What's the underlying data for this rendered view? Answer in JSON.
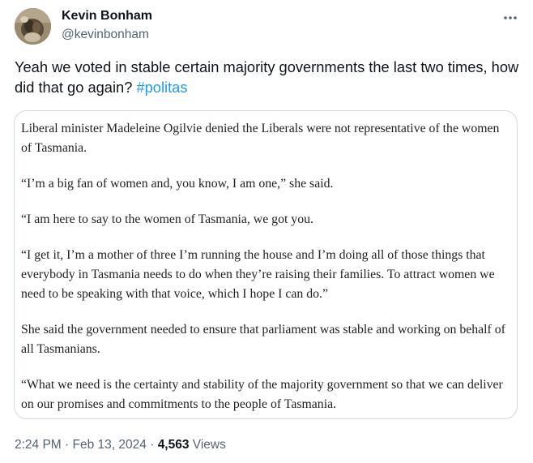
{
  "author": {
    "display_name": "Kevin Bonham",
    "handle": "@kevinbonham"
  },
  "tweet": {
    "text_prefix": "Yeah we voted in stable certain majority governments the last two times, how did that go again?",
    "hashtag": "#politas"
  },
  "quoted_article": {
    "paragraphs": [
      "Liberal minister Madeleine Ogilvie denied the Liberals were not representative of the women of Tasmania.",
      "“I’m a big fan of women and, you know, I am one,” she said.",
      "“I am here to say to the women of Tasmania, we got you.",
      "“I get it, I’m a mother of three I’m running the house and I’m doing all of those things that everybody in Tasmania needs to do when they’re raising their families. To attract women we need to be speaking with that voice, which I hope I can do.”",
      "She said the government needed to ensure that parliament was stable and working on behalf of all Tasmanians.",
      "“What we need is the certainty and stability of the majority government so that we can deliver on our promises and commitments to the people of Tasmania."
    ]
  },
  "meta": {
    "time": "2:24 PM",
    "separator": "·",
    "date": "Feb 13, 2024",
    "views_count": "4,563",
    "views_label": "Views"
  },
  "icons": {
    "more": "more-dots-icon"
  },
  "colors": {
    "text_primary": "#0f1419",
    "text_secondary": "#536471",
    "link": "#1d9bf0",
    "border": "#cfd9de"
  }
}
